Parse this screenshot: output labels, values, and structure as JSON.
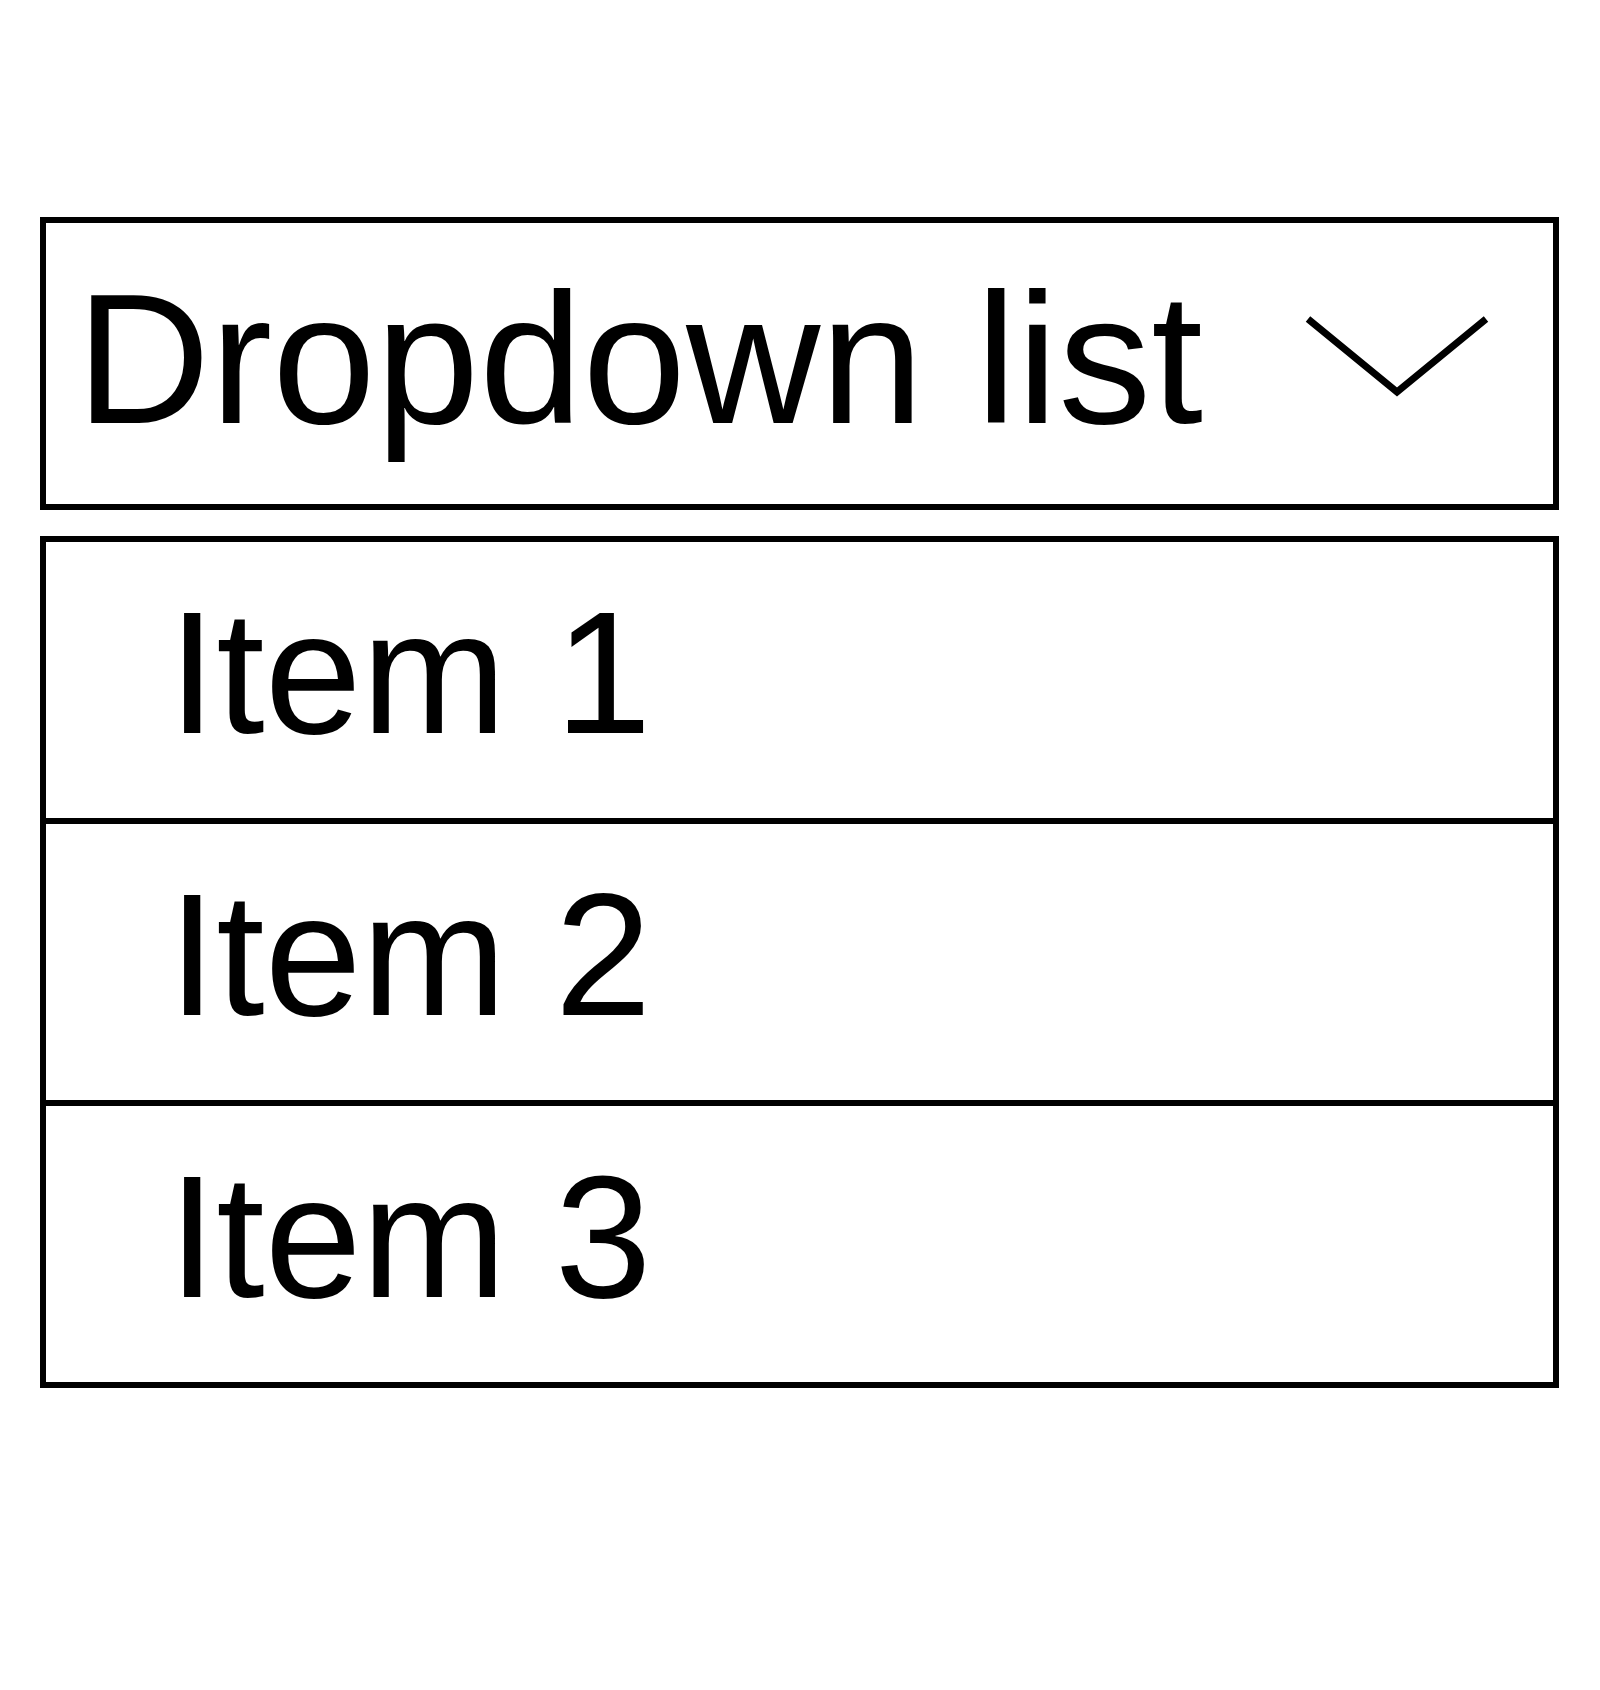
{
  "dropdown": {
    "label": "Dropdown list",
    "expanded": true
  },
  "items": [
    {
      "label": "Item 1"
    },
    {
      "label": "Item 2"
    },
    {
      "label": "Item 3"
    }
  ]
}
